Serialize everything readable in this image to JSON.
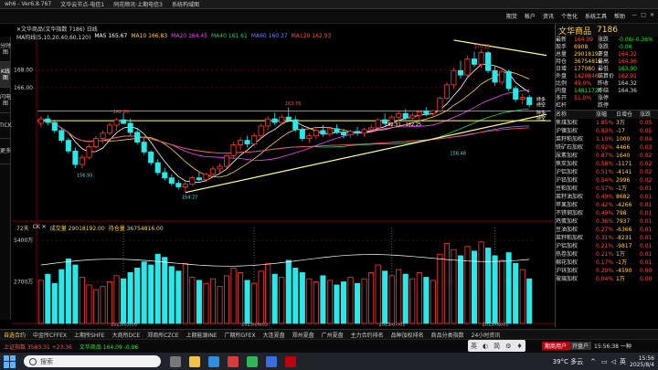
{
  "app": {
    "title": "wh6 - Ver6.8.767",
    "tabs": [
      "文华云节点-电信1",
      "同花顺讯·上期电信3",
      "系统构域图"
    ],
    "winctl": [
      "—",
      "□",
      "✕"
    ]
  },
  "menu": [
    "期货",
    "帐户",
    "资讯",
    "个性化",
    "系统工具",
    "帮助"
  ],
  "left_tabs": [
    "分时图",
    "K线图",
    "闪电图",
    "TICK",
    "更多"
  ],
  "chart": {
    "header": "✕文华商品(文华指数 7186)   日线",
    "ma_items": [
      {
        "label": "MA5 165.67",
        "color": "#ffffff"
      },
      {
        "label": "MA10 166.83",
        "color": "#ffd24a"
      },
      {
        "label": "MA20 164.45",
        "color": "#ff44ff"
      },
      {
        "label": "MA40 161.61",
        "color": "#22d36a"
      },
      {
        "label": "MA60 160.37",
        "color": "#8080ff"
      },
      {
        "label": "MA120 162.93",
        "color": "#ff4a4a"
      }
    ],
    "ma_label_prefix": "MA均线(5,10,20,40,60,120)",
    "volume_header": [
      "72天",
      "CK ✕",
      "成交量 29018192.00",
      "持仓量 36754816.00"
    ],
    "price_labels": [
      "168.00",
      "166.00"
    ],
    "volume_labels": [
      "5400万",
      "2700万"
    ],
    "date_labels": [
      "2025/05/06",
      "2025/06/03",
      "2025/07/01",
      "2025/08/01"
    ],
    "annotations": {
      "high": "170.23",
      "low": "154.27",
      "p1": "156.95",
      "p2": "162.20",
      "p3": "162.31 - 162.25",
      "p4": "163.76",
      "p5": "158.48"
    },
    "markers": [
      "持多",
      "持空",
      "持多",
      "持空"
    ]
  },
  "chart_data": {
    "type": "candlestick",
    "days": 72,
    "series": [
      {
        "name": "K",
        "values": [
          [
            162.0,
            162.8,
            161.6,
            162.5
          ],
          [
            162.5,
            162.9,
            161.8,
            162.1
          ],
          [
            162.1,
            162.4,
            160.9,
            161.2
          ],
          [
            161.2,
            161.5,
            159.8,
            160.1
          ],
          [
            160.1,
            160.4,
            158.6,
            158.9
          ],
          [
            158.9,
            159.3,
            157.0,
            157.4
          ],
          [
            157.4,
            158.5,
            156.95,
            158.2
          ],
          [
            158.2,
            159.7,
            158.0,
            159.4
          ],
          [
            159.4,
            160.6,
            159.2,
            160.3
          ],
          [
            160.3,
            161.2,
            159.8,
            160.9
          ],
          [
            160.9,
            162.1,
            160.7,
            161.8
          ],
          [
            161.8,
            162.6,
            161.2,
            162.4
          ],
          [
            162.4,
            163.2,
            161.9,
            162.0
          ],
          [
            162.0,
            162.5,
            160.7,
            161.0
          ],
          [
            161.0,
            161.5,
            159.6,
            159.9
          ],
          [
            159.9,
            160.4,
            158.5,
            158.8
          ],
          [
            158.8,
            159.0,
            157.3,
            157.6
          ],
          [
            157.6,
            158.0,
            156.2,
            156.5
          ],
          [
            156.5,
            157.0,
            155.6,
            155.9
          ],
          [
            155.9,
            156.3,
            155.0,
            155.3
          ],
          [
            155.3,
            155.7,
            154.6,
            154.9
          ],
          [
            154.9,
            155.5,
            154.27,
            155.2
          ],
          [
            155.2,
            156.1,
            155.0,
            155.9
          ],
          [
            155.9,
            156.6,
            155.5,
            155.7
          ],
          [
            155.7,
            156.5,
            155.4,
            156.3
          ],
          [
            156.3,
            157.2,
            156.0,
            156.9
          ],
          [
            156.9,
            157.5,
            156.4,
            157.2
          ],
          [
            157.2,
            158.6,
            157.0,
            158.4
          ],
          [
            158.4,
            159.9,
            158.1,
            159.6
          ],
          [
            159.6,
            160.5,
            159.0,
            160.1
          ],
          [
            160.1,
            160.6,
            159.3,
            159.7
          ],
          [
            159.7,
            160.9,
            159.4,
            160.6
          ],
          [
            160.6,
            162.0,
            160.3,
            161.7
          ],
          [
            161.7,
            162.8,
            161.2,
            162.5
          ],
          [
            162.5,
            163.2,
            161.8,
            162.1
          ],
          [
            162.1,
            163.0,
            161.9,
            162.7
          ],
          [
            162.7,
            163.76,
            162.1,
            162.4
          ],
          [
            162.4,
            162.8,
            161.0,
            161.3
          ],
          [
            161.3,
            161.6,
            160.0,
            160.3
          ],
          [
            160.3,
            160.9,
            159.8,
            160.6
          ],
          [
            160.6,
            161.5,
            160.2,
            161.2
          ],
          [
            161.2,
            161.8,
            160.5,
            160.8
          ],
          [
            160.8,
            161.6,
            160.5,
            161.4
          ],
          [
            161.4,
            161.9,
            160.8,
            161.0
          ],
          [
            161.0,
            161.4,
            160.3,
            160.7
          ],
          [
            160.7,
            161.3,
            160.4,
            161.1
          ],
          [
            161.1,
            161.6,
            160.6,
            160.9
          ],
          [
            160.9,
            161.5,
            160.5,
            161.3
          ],
          [
            161.3,
            161.9,
            160.9,
            161.5
          ],
          [
            161.5,
            162.6,
            161.3,
            162.4
          ],
          [
            162.4,
            163.1,
            161.8,
            162.0
          ],
          [
            162.0,
            162.9,
            161.6,
            162.7
          ],
          [
            162.7,
            163.4,
            162.2,
            163.1
          ],
          [
            163.1,
            163.6,
            162.4,
            162.6
          ],
          [
            162.6,
            163.2,
            162.0,
            162.9
          ],
          [
            162.9,
            163.5,
            162.4,
            163.3
          ],
          [
            163.3,
            163.8,
            162.8,
            163.1
          ],
          [
            163.1,
            163.5,
            162.6,
            163.4
          ],
          [
            163.4,
            165.0,
            163.2,
            164.8
          ],
          [
            164.8,
            166.6,
            164.6,
            166.3
          ],
          [
            166.3,
            168.2,
            165.9,
            167.9
          ],
          [
            167.9,
            169.0,
            167.0,
            167.4
          ],
          [
            167.4,
            169.6,
            167.1,
            169.2
          ],
          [
            169.2,
            170.0,
            168.3,
            168.6
          ],
          [
            168.6,
            170.23,
            168.2,
            169.9
          ],
          [
            169.9,
            170.1,
            167.6,
            167.9
          ],
          [
            167.9,
            168.4,
            166.2,
            166.6
          ],
          [
            166.6,
            168.2,
            166.3,
            167.8
          ],
          [
            167.8,
            168.0,
            165.6,
            165.9
          ],
          [
            165.9,
            166.2,
            164.4,
            164.7
          ],
          [
            164.7,
            165.3,
            164.1,
            164.9
          ],
          [
            164.9,
            165.2,
            163.8,
            164.09
          ]
        ]
      },
      {
        "name": "成交量",
        "values": [
          28,
          32,
          26,
          35,
          42,
          38,
          30,
          25,
          22,
          24,
          27,
          31,
          29,
          33,
          36,
          40,
          38,
          45,
          43,
          37,
          34,
          39,
          30,
          28,
          26,
          29,
          24,
          31,
          36,
          33,
          28,
          26,
          34,
          39,
          32,
          30,
          41,
          36,
          33,
          29,
          27,
          31,
          28,
          25,
          27,
          30,
          26,
          29,
          33,
          38,
          34,
          31,
          35,
          32,
          29,
          33,
          30,
          28,
          45,
          52,
          48,
          44,
          50,
          47,
          53,
          49,
          44,
          41,
          46,
          39,
          35,
          29
        ]
      }
    ],
    "ylim": [
      152.5,
      171.5
    ],
    "vol_ylim": [
      0,
      60
    ]
  },
  "quote": {
    "name": "文华商品",
    "code": "7186",
    "rows": [
      {
        "l1": "最新",
        "v1": "164.09",
        "c1": "up",
        "l2": "涨跌",
        "v2": "-0.06/-0.36%",
        "c2": "dn"
      },
      {
        "l1": "现手",
        "v1": "6908",
        "c1": "yl",
        "l2": "涨跌",
        "v2": "-0.06",
        "c2": "dn"
      },
      {
        "l1": "总量",
        "v1": "29018192",
        "c1": "yl",
        "l2": "开盘",
        "v2": "164.32",
        "c2": "up"
      },
      {
        "l1": "持仓",
        "v1": "36754816",
        "c1": "yl",
        "l2": "最高",
        "v2": "164.96",
        "c2": "up"
      },
      {
        "l1": "日增",
        "v1": "177080",
        "c1": "yl",
        "l2": "最低",
        "v2": "163.90",
        "c2": "dn"
      },
      {
        "l1": "外盘",
        "v1": "14208467",
        "c1": "up",
        "l2": "结算价",
        "v2": "162.91",
        "c2": "up"
      },
      {
        "l1": "比例",
        "v1": "49.0%",
        "c1": "up",
        "l2": "昨收",
        "v2": "164.32",
        "c2": "wt"
      },
      {
        "l1": "内盘",
        "v1": "14811726",
        "c1": "dn",
        "l2": "昨结",
        "v2": "164.36",
        "c2": "wt"
      },
      {
        "l1": "多开",
        "v1": "51.0%",
        "c1": "up",
        "l2": "涨停",
        "v2": "",
        "c2": "up"
      },
      {
        "l1": "杠杆",
        "v1": "",
        "c1": "wt",
        "l2": "跌停",
        "v2": "",
        "c2": "dn"
      }
    ]
  },
  "panel_list": {
    "headers": [
      "名称",
      "涨幅",
      "日增仓",
      "涨跌"
    ],
    "rows": [
      {
        "n": "焦煤加权",
        "p": "1.85%",
        "z": "3万",
        "d": "0.05",
        "c": "up"
      },
      {
        "n": "沪镍加权",
        "p": "0.83%",
        "z": "-17",
        "d": "0.05",
        "c": "up"
      },
      {
        "n": "菜籽粕加权",
        "p": "1.10%",
        "z": "1000",
        "d": "0.04",
        "c": "up"
      },
      {
        "n": "铁矿石加权",
        "p": "0.92%",
        "z": "4466",
        "d": "0.03",
        "c": "up"
      },
      {
        "n": "尿素加权",
        "p": "0.87%",
        "z": "1640",
        "d": "0.02",
        "c": "up"
      },
      {
        "n": "焦炭加权",
        "p": "0.58%",
        "z": "-1171",
        "d": "0.02",
        "c": "up"
      },
      {
        "n": "沪铝加权",
        "p": "0.51%",
        "z": "-4141",
        "d": "0.02",
        "c": "up"
      },
      {
        "n": "沪铅加权",
        "p": "0.54%",
        "z": "2996",
        "d": "0.02",
        "c": "up"
      },
      {
        "n": "豆粕加权",
        "p": "0.57%",
        "z": "-1万",
        "d": "0.01",
        "c": "up"
      },
      {
        "n": "菜籽油加权",
        "p": "0.49%",
        "z": "8682",
        "d": "0.01",
        "c": "up"
      },
      {
        "n": "苹果加权",
        "p": "0.42%",
        "z": "-4266",
        "d": "0.01",
        "c": "up"
      },
      {
        "n": "不锈钢加权",
        "p": "0.49%",
        "z": "798",
        "d": "0.01",
        "c": "up"
      },
      {
        "n": "鸡蛋加权",
        "p": "0.36%",
        "z": "7937",
        "d": "0.01",
        "c": "up"
      },
      {
        "n": "豆油加权",
        "p": "0.27%",
        "z": "-6366",
        "d": "0.01",
        "c": "up"
      },
      {
        "n": "菜籽粕加权",
        "p": "0.31%",
        "z": "-8231",
        "d": "0.01",
        "c": "up"
      },
      {
        "n": "沪铝加权",
        "p": "0.21%",
        "z": "-9817",
        "d": "0.01",
        "c": "up"
      },
      {
        "n": "热卷加权",
        "p": "0.21%",
        "z": "1万",
        "d": "0.01",
        "c": "up"
      },
      {
        "n": "棉花加权",
        "p": "0.17%",
        "z": "-1万",
        "d": "0.01",
        "c": "up"
      },
      {
        "n": "沪锌加权",
        "p": "0.20%",
        "z": "-4590",
        "d": "0.00",
        "c": "up"
      },
      {
        "n": "玻璃加权",
        "p": "0.04%",
        "z": "1万",
        "d": "0.00",
        "c": "up"
      }
    ]
  },
  "toolbar": [
    "自选合约",
    "中金所CFFEX",
    "上期所SHFE",
    "大商所DCE",
    "郑商所CZCE",
    "上期能源INE",
    "广期所GFEX",
    "大连夏盘",
    "郑州夏盘",
    "广州夏盘",
    "主力合约排名",
    "品种加权排名",
    "商品分类指数",
    "24小时资讯"
  ],
  "status": {
    "idx1": "上证指数 3583.31 +23.36",
    "idx2": "文华商品 164.09 -0.06",
    "ime": [
      "英",
      "◐",
      "简",
      "⚙",
      "♦"
    ],
    "badge": "期商用户",
    "badge2": "开盘户",
    "clock": "15:56:38 一种"
  },
  "taskbar": {
    "search_placeholder": "搜索",
    "weather": "39°C 多云",
    "time": "15:56",
    "date": "2025/8/4"
  }
}
